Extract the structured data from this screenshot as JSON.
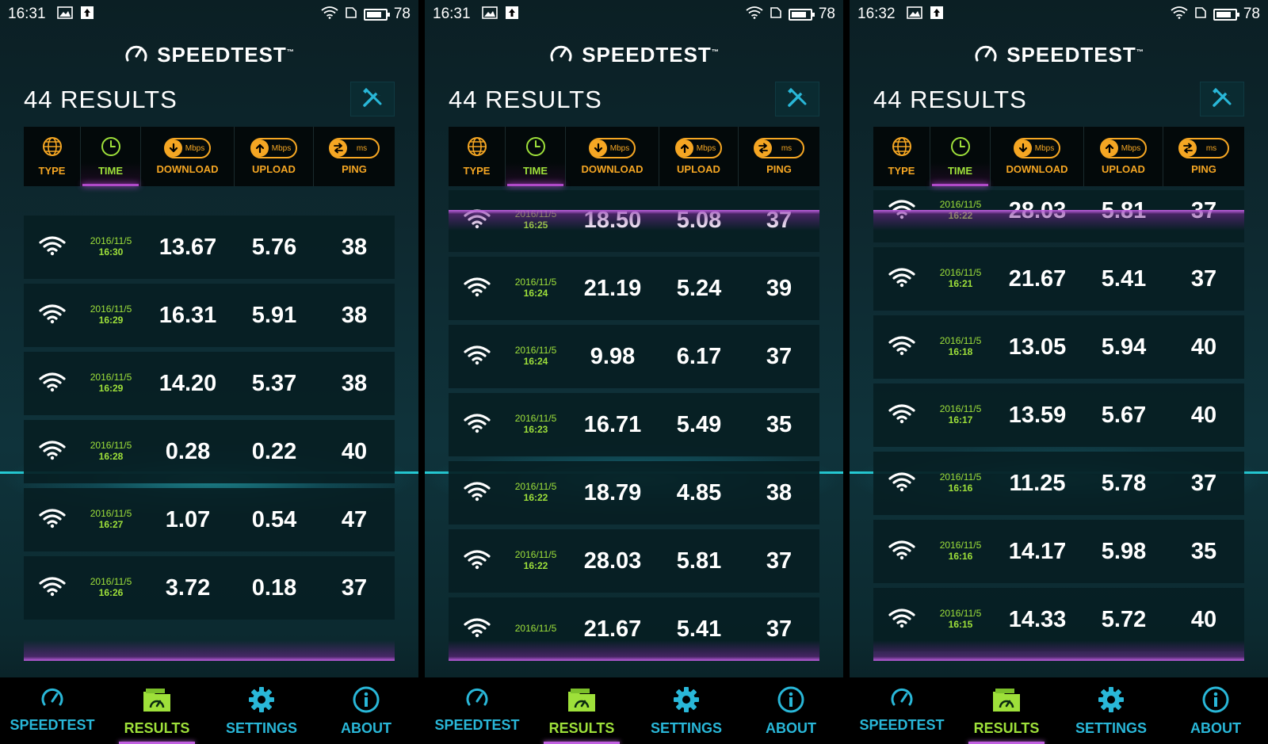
{
  "colors": {
    "accent_orange": "#f5a623",
    "accent_green": "#9ee03a",
    "accent_cyan": "#29b7d8",
    "accent_purple": "#c060e0",
    "background": "#0e2a31"
  },
  "app": {
    "logo_text": "SPEEDTEST",
    "trademark": "™"
  },
  "columns": {
    "type": "TYPE",
    "time": "TIME",
    "download": "DOWNLOAD",
    "download_unit": "Mbps",
    "upload": "UPLOAD",
    "upload_unit": "Mbps",
    "ping": "PING",
    "ping_unit": "ms"
  },
  "nav": {
    "speedtest": "SPEEDTEST",
    "results": "RESULTS",
    "settings": "SETTINGS",
    "about": "ABOUT"
  },
  "panels": [
    {
      "status": {
        "time": "16:31",
        "battery": "78"
      },
      "results_title": "44 RESULTS",
      "rows": [
        {
          "date": "2016/11/5",
          "time": "16:30",
          "download": "13.67",
          "upload": "5.76",
          "ping": "38"
        },
        {
          "date": "2016/11/5",
          "time": "16:29",
          "download": "16.31",
          "upload": "5.91",
          "ping": "38"
        },
        {
          "date": "2016/11/5",
          "time": "16:29",
          "download": "14.20",
          "upload": "5.37",
          "ping": "38"
        },
        {
          "date": "2016/11/5",
          "time": "16:28",
          "download": "0.28",
          "upload": "0.22",
          "ping": "40"
        },
        {
          "date": "2016/11/5",
          "time": "16:27",
          "download": "1.07",
          "upload": "0.54",
          "ping": "47"
        },
        {
          "date": "2016/11/5",
          "time": "16:26",
          "download": "3.72",
          "upload": "0.18",
          "ping": "37"
        }
      ]
    },
    {
      "status": {
        "time": "16:31",
        "battery": "78"
      },
      "results_title": "44 RESULTS",
      "rows": [
        {
          "date": "2016/11/5",
          "time": "16:25",
          "download": "18.50",
          "upload": "5.08",
          "ping": "37"
        },
        {
          "date": "2016/11/5",
          "time": "16:24",
          "download": "21.19",
          "upload": "5.24",
          "ping": "39"
        },
        {
          "date": "2016/11/5",
          "time": "16:24",
          "download": "9.98",
          "upload": "6.17",
          "ping": "37"
        },
        {
          "date": "2016/11/5",
          "time": "16:23",
          "download": "16.71",
          "upload": "5.49",
          "ping": "35"
        },
        {
          "date": "2016/11/5",
          "time": "16:22",
          "download": "18.79",
          "upload": "4.85",
          "ping": "38"
        },
        {
          "date": "2016/11/5",
          "time": "16:22",
          "download": "28.03",
          "upload": "5.81",
          "ping": "37"
        },
        {
          "date": "2016/11/5",
          "time": "",
          "download": "21.67",
          "upload": "5.41",
          "ping": "37"
        }
      ]
    },
    {
      "status": {
        "time": "16:32",
        "battery": "78"
      },
      "results_title": "44 RESULTS",
      "rows": [
        {
          "date": "2016/11/5",
          "time": "16:22",
          "download": "28.03",
          "upload": "5.81",
          "ping": "37"
        },
        {
          "date": "2016/11/5",
          "time": "16:21",
          "download": "21.67",
          "upload": "5.41",
          "ping": "37"
        },
        {
          "date": "2016/11/5",
          "time": "16:18",
          "download": "13.05",
          "upload": "5.94",
          "ping": "40"
        },
        {
          "date": "2016/11/5",
          "time": "16:17",
          "download": "13.59",
          "upload": "5.67",
          "ping": "40"
        },
        {
          "date": "2016/11/5",
          "time": "16:16",
          "download": "11.25",
          "upload": "5.78",
          "ping": "37"
        },
        {
          "date": "2016/11/5",
          "time": "16:16",
          "download": "14.17",
          "upload": "5.98",
          "ping": "35"
        },
        {
          "date": "2016/11/5",
          "time": "16:15",
          "download": "14.33",
          "upload": "5.72",
          "ping": "40"
        }
      ]
    }
  ]
}
